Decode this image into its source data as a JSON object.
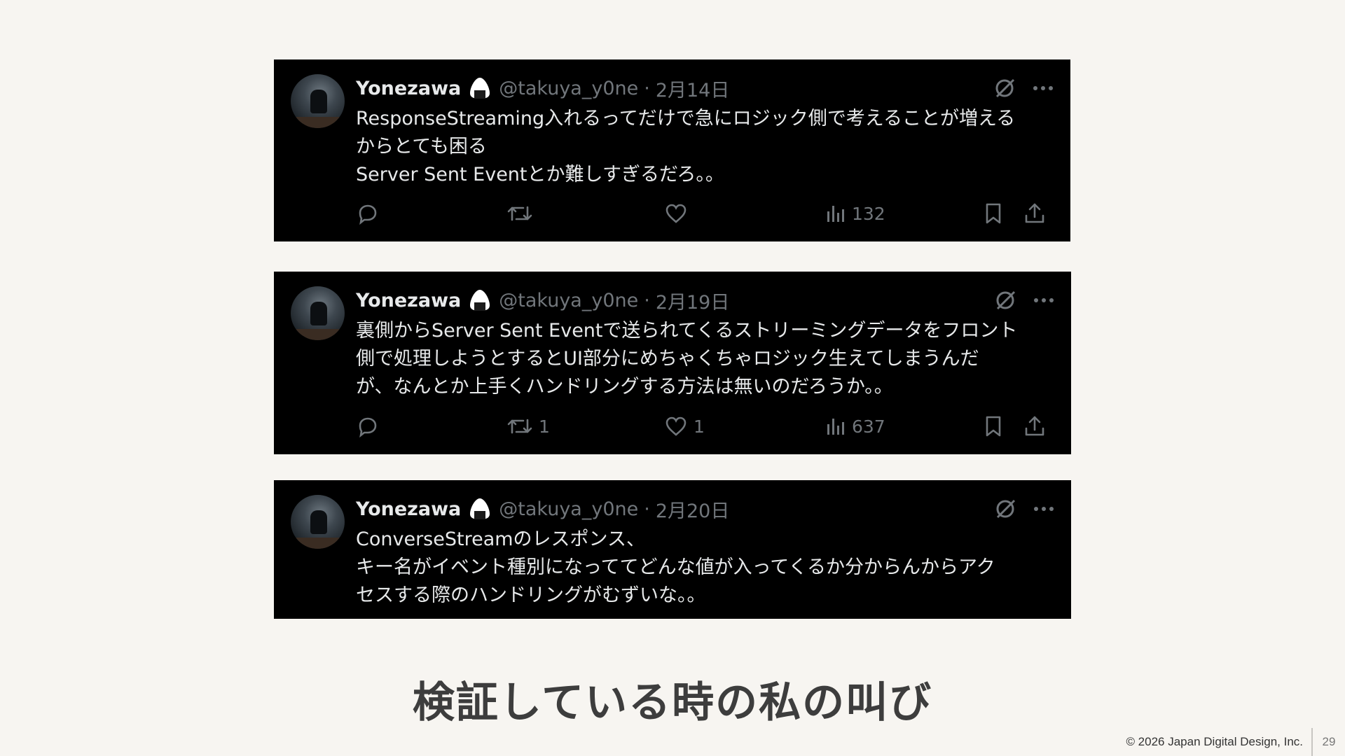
{
  "tweets": [
    {
      "name": "Yonezawa",
      "handle": "@takuya_y0ne",
      "date": "2月14日",
      "lines": [
        "ResponseStreaming入れるってだけで急にロジック側で考えることが増える",
        "からとても困る",
        "Server Sent Eventとか難しすぎるだろ。。"
      ],
      "retweets": "",
      "likes": "",
      "views": "132"
    },
    {
      "name": "Yonezawa",
      "handle": "@takuya_y0ne",
      "date": "2月19日",
      "lines": [
        "裏側からServer Sent Eventで送られてくるストリーミングデータをフロント",
        "側で処理しようとするとUI部分にめちゃくちゃロジック生えてしまうんだ",
        "が、なんとか上手くハンドリングする方法は無いのだろうか。。"
      ],
      "retweets": "1",
      "likes": "1",
      "views": "637"
    },
    {
      "name": "Yonezawa",
      "handle": "@takuya_y0ne",
      "date": "2月20日",
      "lines": [
        "ConverseStreamのレスポンス、",
        "キー名がイベント種別になっててどんな値が入ってくるか分からんからアク",
        "セスする際のハンドリングがむずいな。。"
      ]
    }
  ],
  "header_separator": "·",
  "icons": {
    "emoji": "onigiri-icon",
    "grok": "grok-icon",
    "more": "more-icon",
    "reply": "reply-icon",
    "retweet": "retweet-icon",
    "like": "heart-icon",
    "views": "views-icon",
    "bookmark": "bookmark-icon",
    "share": "share-icon"
  },
  "colors": {
    "page_bg": "#f7f5f1",
    "tweet_bg": "#000000",
    "tweet_text": "#e7e9ea",
    "muted": "#71767b",
    "title": "#3d3d3d"
  },
  "slide": {
    "title": "検証している時の私の叫び",
    "copyright": "© 2026 Japan Digital Design, Inc.",
    "page_number": "29"
  }
}
